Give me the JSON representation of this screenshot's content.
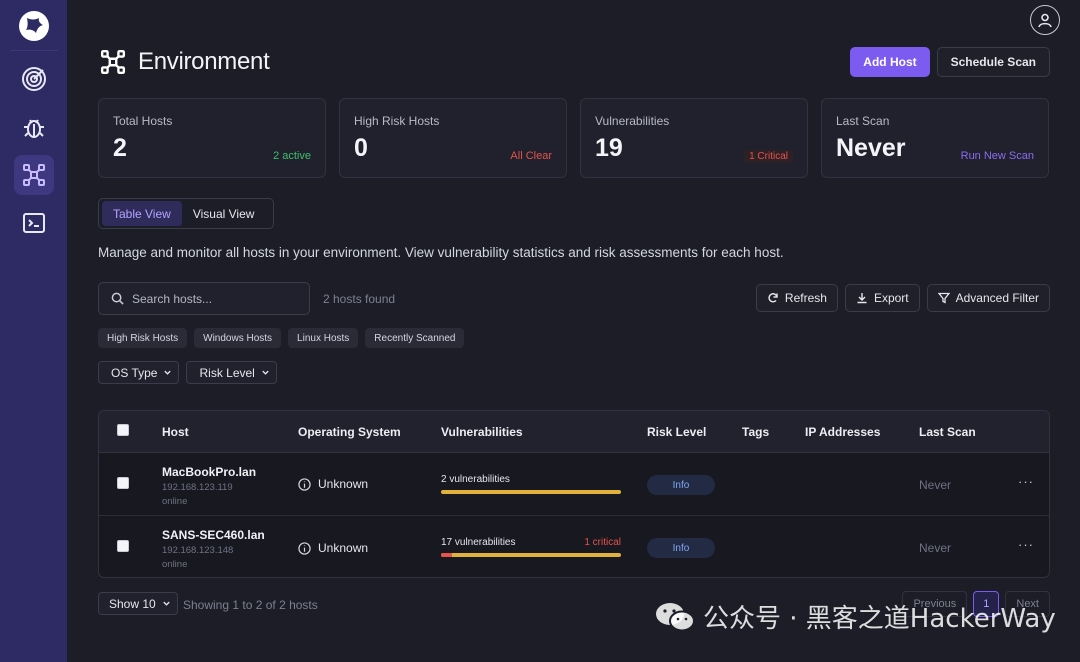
{
  "header": {
    "title": "Environment",
    "add_host": "Add Host",
    "schedule_scan": "Schedule Scan"
  },
  "stats": [
    {
      "label": "Total Hosts",
      "value": "2",
      "note": "2 active"
    },
    {
      "label": "High Risk Hosts",
      "value": "0",
      "note": "All Clear"
    },
    {
      "label": "Vulnerabilities",
      "value": "19",
      "note": "1 Critical"
    },
    {
      "label": "Last Scan",
      "value": "Never",
      "note": "Run New Scan"
    }
  ],
  "view_toggle": {
    "table": "Table View",
    "visual": "Visual View"
  },
  "description": "Manage and monitor all hosts in your environment. View vulnerability statistics and risk assessments for each host.",
  "search": {
    "placeholder": "Search hosts...",
    "count": "2 hosts found"
  },
  "toolbar": {
    "refresh": "Refresh",
    "export": "Export",
    "advanced_filter": "Advanced Filter"
  },
  "chips": [
    "High Risk Hosts",
    "Windows Hosts",
    "Linux Hosts",
    "Recently Scanned"
  ],
  "filters": {
    "os_type": "OS Type",
    "risk_level": "Risk Level"
  },
  "table": {
    "columns": [
      "Host",
      "Operating System",
      "Vulnerabilities",
      "Risk Level",
      "Tags",
      "IP Addresses",
      "Last Scan"
    ],
    "rows": [
      {
        "name": "MacBookPro.lan",
        "ip": "192.168.123.119",
        "status": "online",
        "os": "Unknown",
        "vulns": "2 vulnerabilities",
        "critical": "",
        "critical_fraction": 0,
        "risk": "Info",
        "last_scan": "Never",
        "more": "···"
      },
      {
        "name": "SANS-SEC460.lan",
        "ip": "192.168.123.148",
        "status": "online",
        "os": "Unknown",
        "vulns": "17 vulnerabilities",
        "critical": "1 critical",
        "critical_fraction": 0.06,
        "risk": "Info",
        "last_scan": "Never",
        "more": "···"
      }
    ]
  },
  "footer": {
    "page_size": "Show 10",
    "showing": "Showing 1 to 2 of 2 hosts",
    "previous": "Previous",
    "page": "1",
    "next": "Next"
  },
  "watermark": {
    "text": "公众号 · 黑客之道HackerWay"
  },
  "colors": {
    "accent": "#7c5cf0",
    "sidebar": "#2e2a63",
    "success": "#3fbf6a",
    "danger": "#e5534b",
    "warning": "#e0b13c"
  }
}
